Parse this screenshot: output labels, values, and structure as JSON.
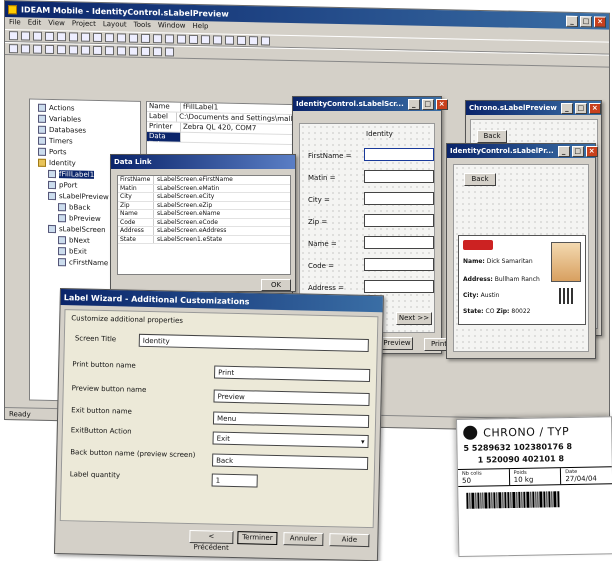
{
  "main_window": {
    "title": "IDEAM Mobile - IdentityControl.sLabelPreview",
    "menu": [
      "File",
      "Edit",
      "View",
      "Project",
      "Layout",
      "Tools",
      "Window",
      "Help"
    ],
    "status": "Ready"
  },
  "tree": {
    "items": [
      {
        "label": "Actions"
      },
      {
        "label": "Variables"
      },
      {
        "label": "Databases"
      },
      {
        "label": "Timers"
      },
      {
        "label": "Ports"
      },
      {
        "label": "Identity"
      },
      {
        "label": "fFillLabel1"
      },
      {
        "label": "pPort"
      },
      {
        "label": "sLabelPreview"
      },
      {
        "label": "bBack"
      },
      {
        "label": "bPreview"
      },
      {
        "label": "sLabelScreen"
      },
      {
        "label": "bNext"
      },
      {
        "label": "bExit"
      },
      {
        "label": "cFirstName"
      }
    ]
  },
  "properties": {
    "rows": [
      {
        "k": "Name",
        "v": "fFillLabel1"
      },
      {
        "k": "Label",
        "v": "C:\\Documents and Settings\\mallmo\\M"
      },
      {
        "k": "Printer",
        "v": "Zebra QL 420, COM7"
      },
      {
        "k": "Data links",
        "v": ""
      }
    ]
  },
  "identity_screen": {
    "title": "IdentityControl.sLabelScr...",
    "header": "Identity",
    "fields": [
      "FirstName =",
      "Matin =",
      "City =",
      "Zip =",
      "Name =",
      "Code =",
      "Address ="
    ],
    "next_label": "Next >>",
    "preview_label": "Preview",
    "print_label": "Print"
  },
  "data_link": {
    "title": "Data Link",
    "rows": [
      {
        "a": "FirstName",
        "b": "sLabelScreen.eFirstName"
      },
      {
        "a": "Matin",
        "b": "sLabelScreen.eMatin"
      },
      {
        "a": "City",
        "b": "sLabelScreen.eCity"
      },
      {
        "a": "Zip",
        "b": "sLabelScreen.eZip"
      },
      {
        "a": "Name",
        "b": "sLabelScreen.eName"
      },
      {
        "a": "Code",
        "b": "sLabelScreen.eCode"
      },
      {
        "a": "Address",
        "b": "sLabelScreen.eAddress"
      },
      {
        "a": "State",
        "b": "sLabelScreen1.eState"
      }
    ],
    "ok_label": "OK"
  },
  "chrono_preview": {
    "title": "Chrono.sLabelPreview",
    "back_label": "Back"
  },
  "identity_preview": {
    "title": "IdentityControl.sLabelPr...",
    "back_label": "Back",
    "card": {
      "name_key": "Name:",
      "name_val": "Dick Samaritan",
      "address_key": "Address:",
      "address_val": "Bullham Ranch",
      "city_key": "City:",
      "city_val": "Austin",
      "state_key": "State:",
      "state_val": "CO",
      "zip_key": "Zip:",
      "zip_val": "80022"
    }
  },
  "wizard": {
    "title": "Label Wizard - Additional Customizations",
    "subtitle": "Customize additional properties",
    "screen_title_label": "Screen Title",
    "screen_title_value": "Identity",
    "fields": [
      {
        "label": "Print button name",
        "value": "Print"
      },
      {
        "label": "Preview button name",
        "value": "Preview"
      },
      {
        "label": "Exit button name",
        "value": "Menu"
      },
      {
        "label": "ExitButton Action",
        "value": "Exit"
      },
      {
        "label": "Back button name (preview screen)",
        "value": "Back"
      },
      {
        "label": "Label quantity",
        "value": "1"
      }
    ],
    "buttons": {
      "prev": "< Précédent",
      "finish": "Terminer",
      "cancel": "Annuler",
      "help": "Aide"
    }
  },
  "chrono_label": {
    "brand": "CHRONO / TYP",
    "line1": "5 5289632 102380176 8",
    "line2": "1 520090 402101 8",
    "col1_head": "Nb colis",
    "col1_val": "50",
    "col2_head": "Poids",
    "col2_val": "10 kg",
    "col3_head": "Date",
    "col3_val": "27/04/04"
  }
}
